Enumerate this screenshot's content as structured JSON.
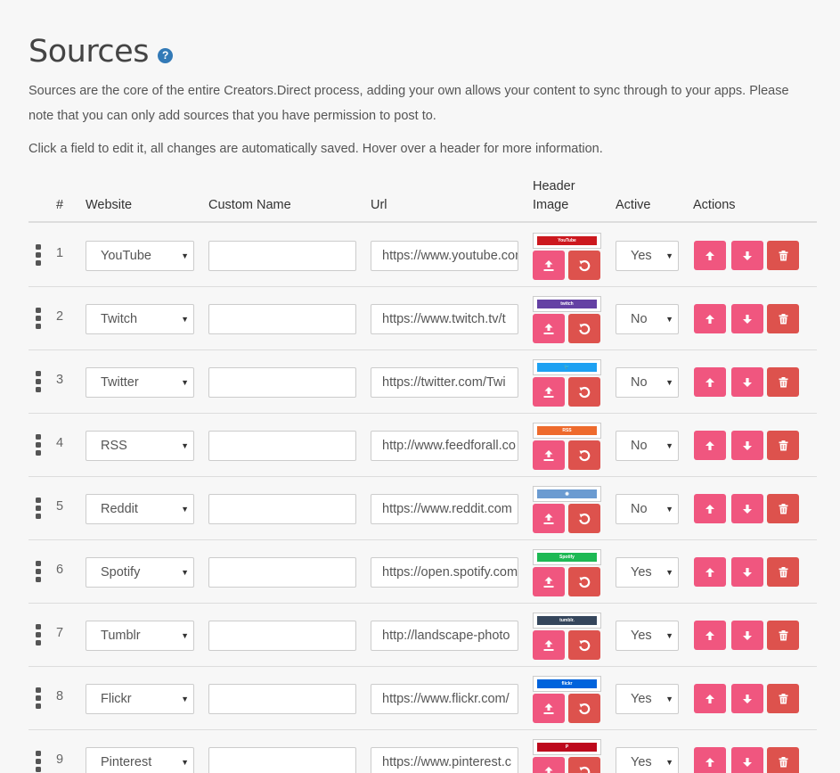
{
  "page": {
    "title": "Sources",
    "help_icon": "question-circle-icon",
    "description": "Sources are the core of the entire Creators.Direct process, adding your own allows your content to sync through to your apps. Please note that you can only add sources that you have permission to post to.",
    "instructions": "Click a field to edit it, all changes are automatically saved. Hover over a header for more information."
  },
  "table": {
    "headers": {
      "num": "#",
      "website": "Website",
      "custom_name": "Custom Name",
      "url": "Url",
      "header_image_line1": "Header",
      "header_image_line2": "Image",
      "active": "Active",
      "actions": "Actions"
    },
    "rows": [
      {
        "num": "1",
        "website": "YouTube",
        "custom_name": "",
        "url": "https://www.youtube.com",
        "header_color": "#cc181e",
        "header_text": "YouTube",
        "active": "Yes"
      },
      {
        "num": "2",
        "website": "Twitch",
        "custom_name": "",
        "url": "https://www.twitch.tv/t",
        "header_color": "#6441a4",
        "header_text": "twitch",
        "active": "No"
      },
      {
        "num": "3",
        "website": "Twitter",
        "custom_name": "",
        "url": "https://twitter.com/Twi",
        "header_color": "#1da1f2",
        "header_text": "🐦",
        "active": "No"
      },
      {
        "num": "4",
        "website": "RSS",
        "custom_name": "",
        "url": "http://www.feedforall.co",
        "header_color": "#ee6b2d",
        "header_text": "RSS",
        "active": "No"
      },
      {
        "num": "5",
        "website": "Reddit",
        "custom_name": "",
        "url": "https://www.reddit.com",
        "header_color": "#6b9bd1",
        "header_text": "◉",
        "active": "No"
      },
      {
        "num": "6",
        "website": "Spotify",
        "custom_name": "",
        "url": "https://open.spotify.com",
        "header_color": "#1db954",
        "header_text": "Spotify",
        "active": "Yes"
      },
      {
        "num": "7",
        "website": "Tumblr",
        "custom_name": "",
        "url": "http://landscape-photo",
        "header_color": "#35465c",
        "header_text": "tumblr.",
        "active": "Yes"
      },
      {
        "num": "8",
        "website": "Flickr",
        "custom_name": "",
        "url": "https://www.flickr.com/",
        "header_color": "#0063dc",
        "header_text": "flickr",
        "active": "Yes"
      },
      {
        "num": "9",
        "website": "Pinterest",
        "custom_name": "",
        "url": "https://www.pinterest.c",
        "header_color": "#bd081c",
        "header_text": "P",
        "active": "Yes"
      }
    ]
  },
  "icons": {
    "drag": "drag-handle-icon",
    "upload": "upload-icon",
    "reset": "undo-icon",
    "up": "arrow-up-icon",
    "down": "arrow-down-icon",
    "delete": "trash-icon"
  },
  "colors": {
    "pink": "#f0567f",
    "red": "#dd524d",
    "help_blue": "#337ab7"
  }
}
